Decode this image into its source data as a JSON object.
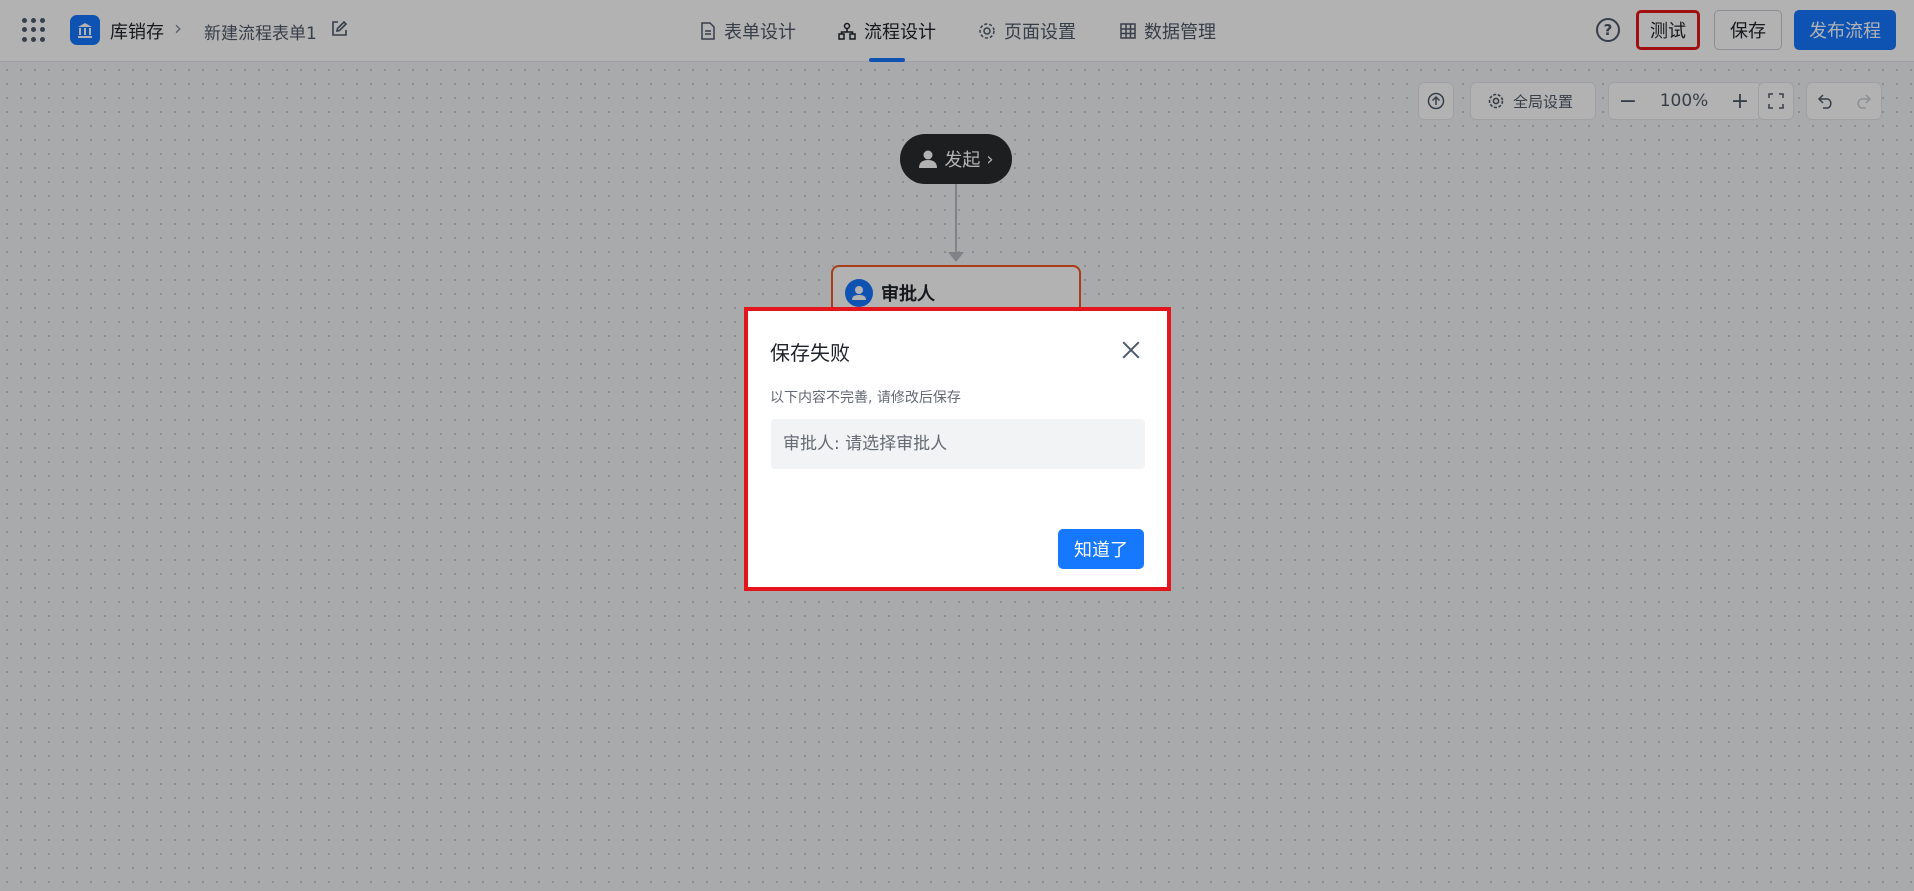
{
  "header": {
    "app_name": "库销存",
    "form_name": "新建流程表单1",
    "tabs": [
      {
        "label": "表单设计"
      },
      {
        "label": "流程设计"
      },
      {
        "label": "页面设置"
      },
      {
        "label": "数据管理"
      }
    ],
    "active_tab": "流程设计",
    "help_label": "?",
    "test_label": "测试",
    "save_label": "保存",
    "publish_label": "发布流程"
  },
  "toolbar": {
    "global_settings_label": "全局设置",
    "zoom_out_label": "−",
    "zoom_level": "100%",
    "zoom_in_label": "+"
  },
  "flow": {
    "start_label": "发起",
    "start_chevron": "›",
    "approver_title": "审批人"
  },
  "dialog": {
    "title": "保存失败",
    "description": "以下内容不完善, 请修改后保存",
    "items": [
      {
        "text": "审批人: 请选择审批人"
      }
    ],
    "ok_label": "知道了"
  },
  "colors": {
    "primary": "#1677ff",
    "highlight": "#e5161b",
    "approver_border": "#f05a24"
  }
}
